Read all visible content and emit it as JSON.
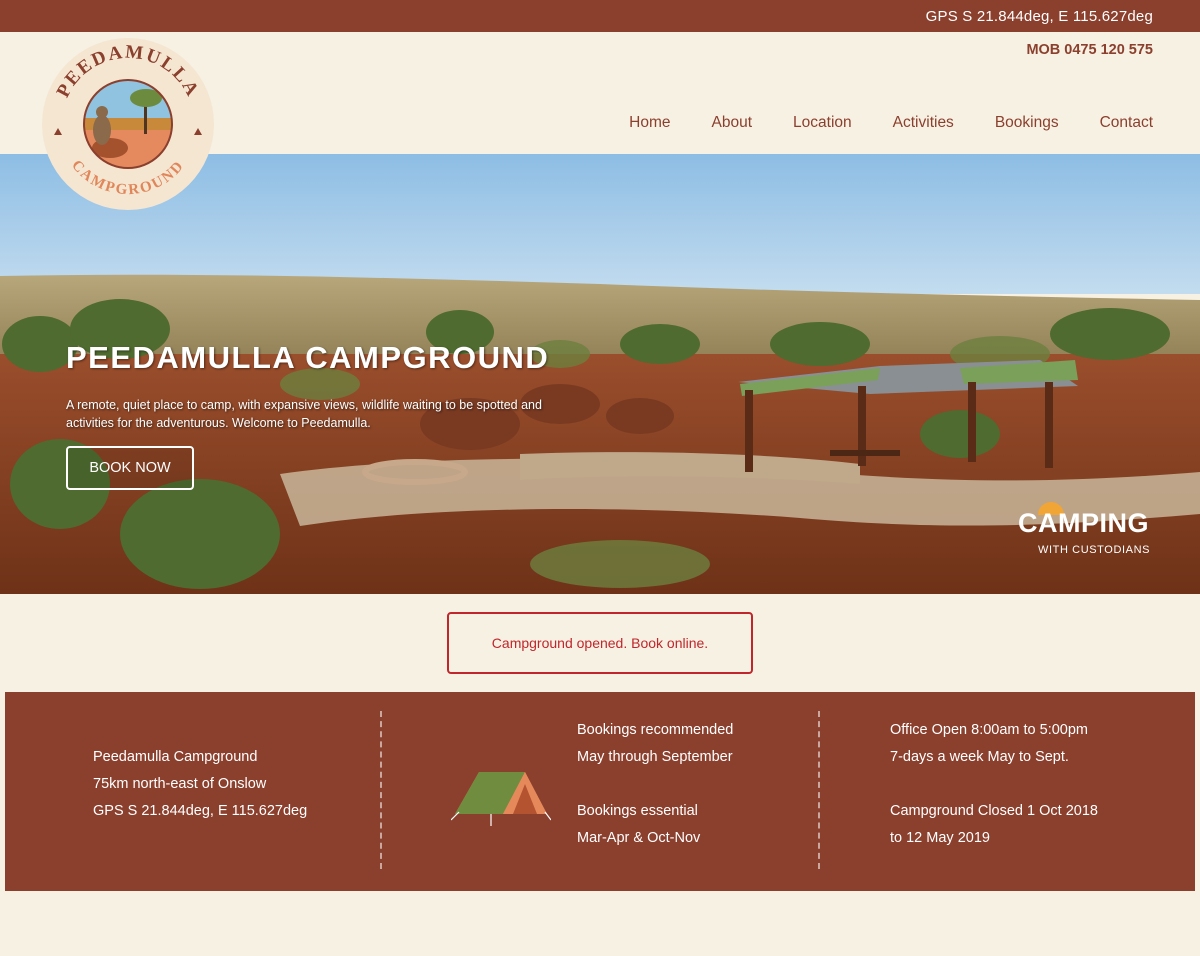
{
  "topbar": {
    "gps": "GPS  S 21.844deg,  E 115.627deg"
  },
  "header": {
    "mob": "MOB 0475 120 575"
  },
  "logo": {
    "name": "PEEDAMULLA",
    "subtitle": "CAMPGROUND"
  },
  "nav": {
    "items": [
      {
        "label": "Home"
      },
      {
        "label": "About"
      },
      {
        "label": "Location"
      },
      {
        "label": "Activities"
      },
      {
        "label": "Bookings"
      },
      {
        "label": "Contact"
      }
    ]
  },
  "hero": {
    "title": "PEEDAMULLA CAMPGROUND",
    "text": "A remote, quiet place to camp, with expansive views, wildlife waiting to be spotted and activities for the adventurous.  Welcome to Peedamulla.",
    "button": "BOOK NOW",
    "badge_main": "CAMPING",
    "badge_sub": "WITH CUSTODIANS"
  },
  "notice": {
    "text": "Campground opened. Book online."
  },
  "footer": {
    "address": [
      "Peedamulla Campground",
      "75km north-east of Onslow",
      "GPS S 21.844deg, E 115.627deg"
    ],
    "bookings": [
      "Bookings recommended",
      "May through September",
      "",
      "Bookings essential",
      "Mar-Apr & Oct-Nov"
    ],
    "office": [
      "Office Open 8:00am to 5:00pm",
      "7-days a week  May to Sept.",
      "",
      "Campground Closed 1 Oct 2018",
      "to 12 May 2019"
    ]
  },
  "colors": {
    "brand": "#8b3f2d",
    "background": "#f7f1e4",
    "notice": "#c0262b"
  }
}
